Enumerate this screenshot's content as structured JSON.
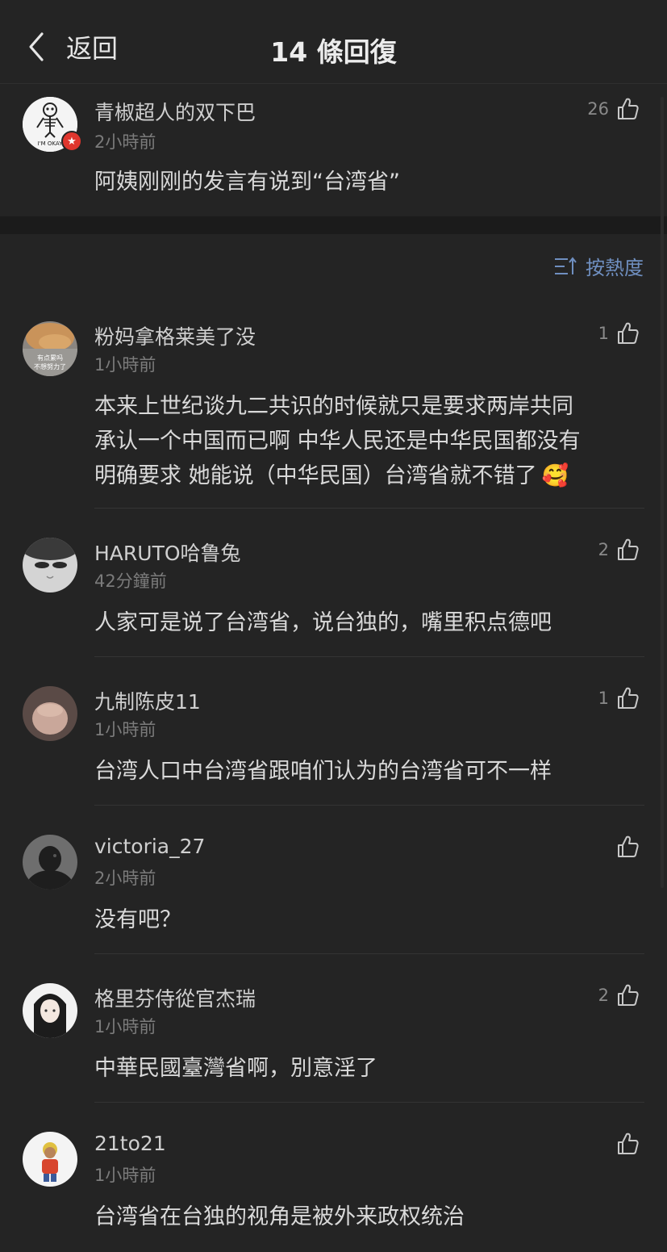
{
  "header": {
    "back_label": "返回",
    "title": "14 條回復"
  },
  "root": {
    "username": "青椒超人的双下巴",
    "time": "2小時前",
    "likes": "26",
    "text": "阿姨刚刚的发言有说到“台湾省”",
    "avatar_caption": "I'M OKAY",
    "verified_icon": "star-badge-icon"
  },
  "sort": {
    "label": "按熱度",
    "icon": "sort-icon"
  },
  "replies": [
    {
      "username": "粉妈拿格莱美了没",
      "time": "1小時前",
      "likes": "1",
      "lines": [
        "本来上世纪谈九二共识的时候就只是要求两岸共同",
        "承认一个中国而已啊 中华人民还是中华民国都没有",
        "明确要求 她能说（中华民国）台湾省就不错了"
      ],
      "emoji": "🥰",
      "avatar_caption": [
        "有点累吗",
        "不想努力了"
      ]
    },
    {
      "username": "HARUTO哈鲁兔",
      "time": "42分鐘前",
      "likes": "2",
      "lines": [
        "人家可是说了台湾省，说台独的，嘴里积点德吧"
      ]
    },
    {
      "username": "九制陈皮11",
      "time": "1小時前",
      "likes": "1",
      "lines": [
        "台湾人口中台湾省跟咱们认为的台湾省可不一样"
      ]
    },
    {
      "username": "victoria_27",
      "time": "2小時前",
      "likes": "",
      "lines": [
        "没有吧？"
      ]
    },
    {
      "username": "格里芬侍從官杰瑞",
      "time": "1小時前",
      "likes": "2",
      "lines": [
        "中華民國臺灣省啊，別意淫了"
      ]
    },
    {
      "username": "21to21",
      "time": "1小時前",
      "likes": "",
      "lines": [
        "台湾省在台独的视角是被外来政权统治"
      ]
    }
  ],
  "colors": {
    "background": "#242424",
    "divider": "#1b1b1b",
    "accent": "#6f8fc0",
    "badge": "#e0362e"
  }
}
